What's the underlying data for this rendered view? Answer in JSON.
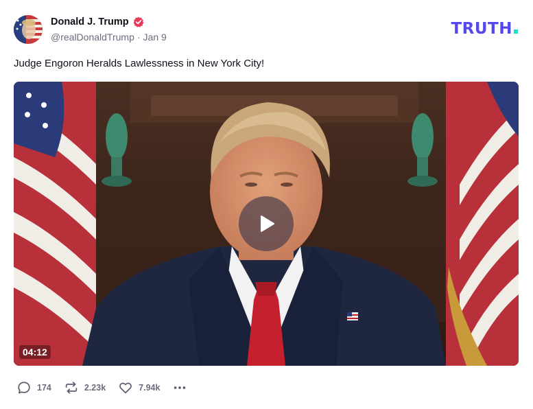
{
  "post": {
    "author": {
      "display_name": "Donald J. Trump",
      "handle": "@realDonaldTrump",
      "separator": "·",
      "date": "Jan 9",
      "verified": true
    },
    "brand": {
      "logo_text": "TRUTH",
      "text_color": "#5448ee",
      "dot_color": "#17e0c3"
    },
    "text": "Judge Engoron Heralds Lawlessness in New York City!",
    "video": {
      "duration": "04:12"
    },
    "actions": {
      "replies": "174",
      "retruths": "2.23k",
      "likes": "7.94k"
    }
  },
  "icons": {
    "verified": "verified-badge-icon",
    "play": "play-icon",
    "reply": "speech-bubble-icon",
    "retruth": "repost-arrows-icon",
    "like": "heart-icon",
    "more": "ellipsis-icon"
  },
  "colors": {
    "verified_badge": "#e83a5b",
    "muted_text": "#6b6b7e"
  }
}
